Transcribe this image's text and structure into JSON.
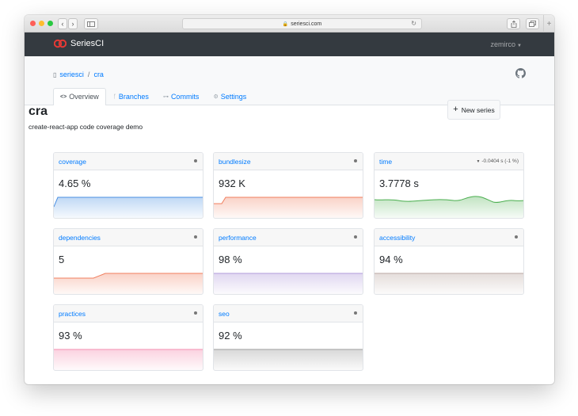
{
  "browser": {
    "url": "seriesci.com"
  },
  "navbar": {
    "brand": "SeriesCI",
    "user": "zemirco"
  },
  "breadcrumb": {
    "owner": "seriesci",
    "separator": "/",
    "repo": "cra"
  },
  "tabs": [
    {
      "label": "Overview",
      "icon": "code-icon",
      "active": true
    },
    {
      "label": "Branches",
      "icon": "branch-icon",
      "active": false
    },
    {
      "label": "Commits",
      "icon": "commit-icon",
      "active": false
    },
    {
      "label": "Settings",
      "icon": "gear-icon",
      "active": false
    }
  ],
  "page": {
    "title": "cra",
    "description": "create-react-app code coverage demo",
    "new_series_label": "New series"
  },
  "series": [
    {
      "name": "coverage",
      "value": "4.65 %",
      "color": "#4a90e2"
    },
    {
      "name": "bundlesize",
      "value": "932 K",
      "color": "#f07f5f"
    },
    {
      "name": "time",
      "value": "3.7778 s",
      "color": "#4caf50",
      "delta": "-0.0404 s (-1 %)"
    },
    {
      "name": "dependencies",
      "value": "5",
      "color": "#f07f5f"
    },
    {
      "name": "performance",
      "value": "98 %",
      "color": "#b39ddb"
    },
    {
      "name": "accessibility",
      "value": "94 %",
      "color": "#bcaaa4"
    },
    {
      "name": "practices",
      "value": "93 %",
      "color": "#f48fb1"
    },
    {
      "name": "seo",
      "value": "92 %",
      "color": "#9e9e9e"
    }
  ]
}
